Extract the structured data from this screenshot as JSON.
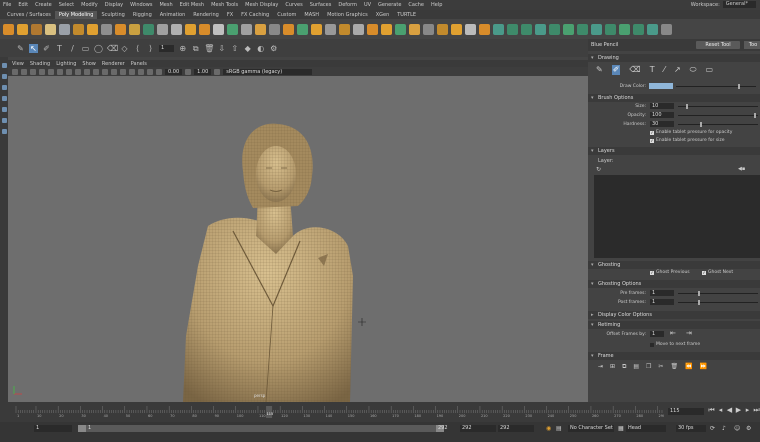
{
  "menubar": {
    "items": [
      "File",
      "Edit",
      "Create",
      "Select",
      "Modify",
      "Display",
      "Windows",
      "Mesh",
      "Edit Mesh",
      "Mesh Tools",
      "Mesh Display",
      "Curves",
      "Surfaces",
      "Deform",
      "UV",
      "Generate",
      "Cache",
      "Help"
    ],
    "workspace_label": "Workspace:",
    "workspace_value": "General*"
  },
  "shelf_tabs": [
    "Curves / Surfaces",
    "Poly Modeling",
    "Sculpting",
    "Rigging",
    "Animation",
    "Rendering",
    "FX",
    "FX Caching",
    "Custom",
    "MASH",
    "Motion Graphics",
    "XGen",
    "TURTLE"
  ],
  "toolbar": {
    "field_value": "1"
  },
  "viewport": {
    "menu": [
      "View",
      "Shading",
      "Lighting",
      "Show",
      "Renderer",
      "Panels"
    ],
    "num1": "0.00",
    "num2": "1.00",
    "colorspace": "sRGB gamma (legacy)",
    "camera_label": "persp"
  },
  "timeline": {
    "ticks": [
      "1",
      "10",
      "20",
      "30",
      "40",
      "50",
      "60",
      "70",
      "80",
      "90",
      "100",
      "110",
      "120",
      "130",
      "140",
      "150",
      "160",
      "170",
      "180",
      "190",
      "200",
      "210",
      "220",
      "230",
      "240",
      "250",
      "260",
      "270",
      "280",
      "290"
    ],
    "current_frame": "115",
    "frame_field": "115"
  },
  "range": {
    "start": "1",
    "inner_start": "1",
    "inner_end": "292",
    "end": "292",
    "end2": "292",
    "character_set": "No Character Set",
    "anim_layer": "Head",
    "fps": "30 fps"
  },
  "panel": {
    "title": "Blue Pencil",
    "reset_tool": "Reset Tool",
    "tool_tab": "Too",
    "drawing": {
      "header": "Drawing",
      "draw_color_label": "Draw Color:"
    },
    "brush": {
      "header": "Brush Options",
      "size_label": "Size:",
      "size_value": "10",
      "opacity_label": "Opacity:",
      "opacity_value": "100",
      "hardness_label": "Hardness:",
      "hardness_value": "30",
      "cb1": "Enable tablet pressure for opacity",
      "cb2": "Enable tablet pressure for size"
    },
    "layers": {
      "header": "Layers",
      "label": "Layer:"
    },
    "ghosting": {
      "header": "Ghosting",
      "prev": "Ghost Previous",
      "next": "Ghost Next"
    },
    "ghosting_options": {
      "header": "Ghosting Options",
      "pre_label": "Pre frames:",
      "pre_value": "1",
      "post_label": "Post frames:",
      "post_value": "1"
    },
    "display_color": {
      "header": "Display Color Options"
    },
    "retiming": {
      "header": "Retiming",
      "offset_label": "Offset Frames by:",
      "offset_value": "1",
      "move_label": "Move to next frame"
    },
    "frame": {
      "header": "Frame"
    }
  },
  "colors": {
    "accent": "#5a87b8",
    "draw_color": "#8fb6d9",
    "model_skin": "#b79d6f"
  }
}
